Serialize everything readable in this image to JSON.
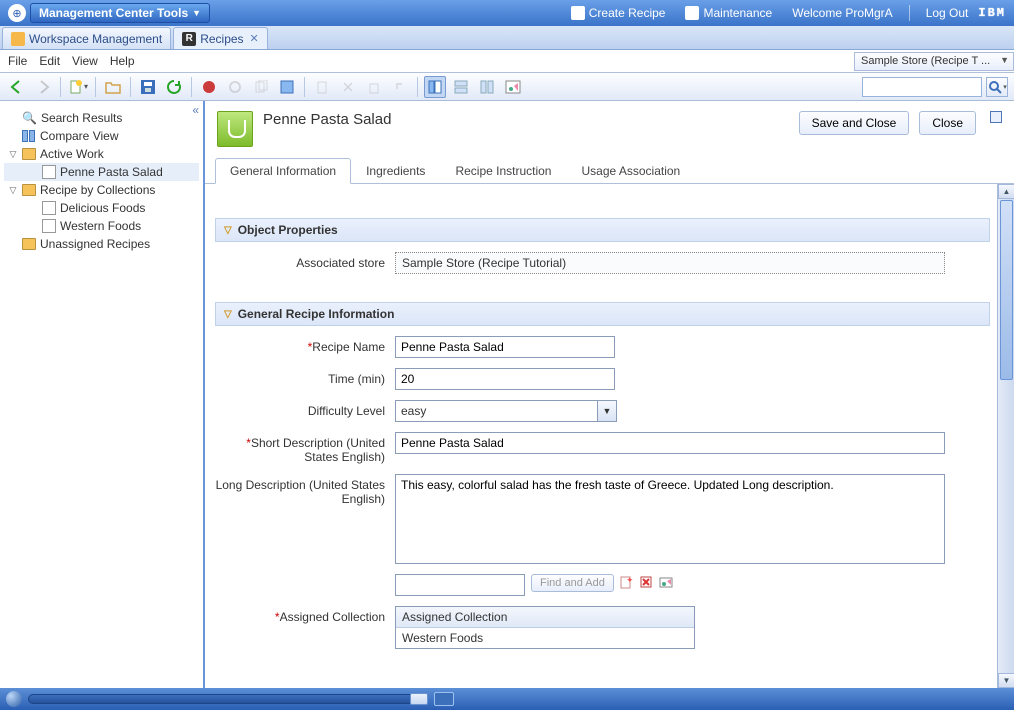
{
  "header": {
    "tools_label": "Management Center Tools",
    "create_recipe": "Create Recipe",
    "maintenance": "Maintenance",
    "welcome": "Welcome ProMgrA",
    "logout": "Log Out",
    "ibm": "IBM"
  },
  "ws_tabs": {
    "workspace": "Workspace Management",
    "recipes": "Recipes",
    "recipes_icon": "R"
  },
  "menu": {
    "file": "File",
    "edit": "Edit",
    "view": "View",
    "help": "Help"
  },
  "store_selector": "Sample Store (Recipe T ...",
  "search": {
    "placeholder": ""
  },
  "tree": {
    "search_results": "Search Results",
    "compare_view": "Compare View",
    "active_work": "Active Work",
    "penne": "Penne Pasta Salad",
    "recipe_by_collections": "Recipe by Collections",
    "delicious": "Delicious Foods",
    "western": "Western Foods",
    "unassigned": "Unassigned Recipes"
  },
  "editor": {
    "title": "Penne Pasta Salad",
    "save_and_close": "Save and Close",
    "close": "Close",
    "tabs": {
      "general": "General Information",
      "ingredients": "Ingredients",
      "instruction": "Recipe Instruction",
      "usage": "Usage Association"
    },
    "sections": {
      "object_props": "Object Properties",
      "recipe_info": "General Recipe Information"
    },
    "labels": {
      "associated_store": "Associated store",
      "recipe_name": "Recipe Name",
      "time": "Time (min)",
      "difficulty": "Difficulty Level",
      "short_desc": "Short Description (United States English)",
      "long_desc": "Long Description (United States English)",
      "assigned_collection": "Assigned Collection"
    },
    "values": {
      "associated_store": "Sample Store (Recipe Tutorial)",
      "recipe_name": "Penne Pasta Salad",
      "time": "20",
      "difficulty": "easy",
      "short_desc": "Penne Pasta Salad",
      "long_desc": "This easy, colorful salad has the fresh taste of Greece. Updated Long description.",
      "find_and_add": "Find and Add",
      "assigned_header": "Assigned Collection",
      "assigned_value": "Western Foods"
    }
  }
}
